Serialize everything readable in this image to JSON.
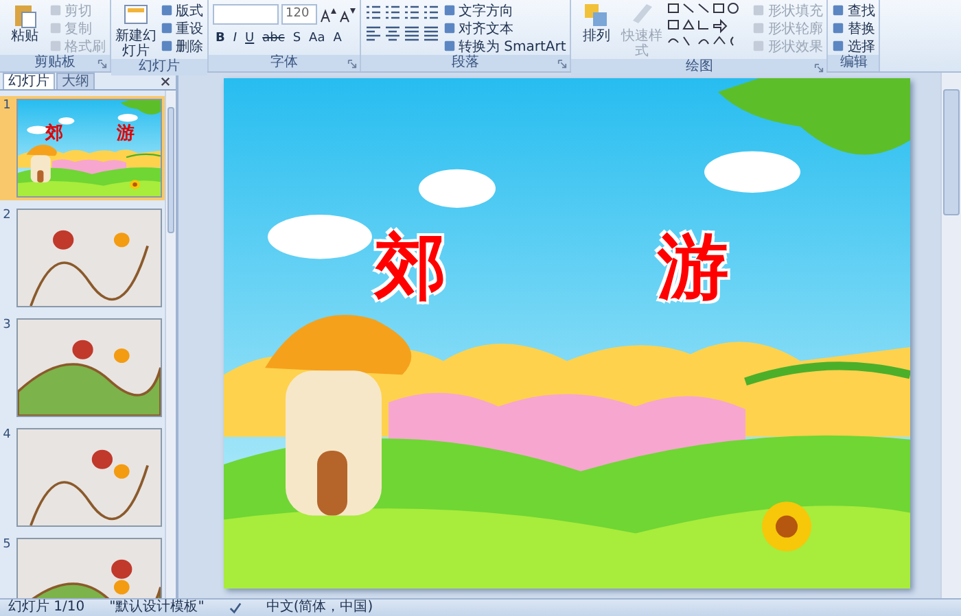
{
  "ribbon": {
    "groups": [
      {
        "kind": "standard",
        "label": "剪贴板",
        "launcher": true,
        "large": [
          {
            "label": "粘贴",
            "kind": "paste"
          }
        ],
        "items": [
          {
            "label": "剪切",
            "disabled": true
          },
          {
            "label": "复制",
            "disabled": true
          },
          {
            "label": "格式刷",
            "disabled": true
          }
        ]
      },
      {
        "kind": "standard",
        "label": "幻灯片",
        "launcher": false,
        "large": [
          {
            "label": "新建幻灯片",
            "kind": "slide"
          }
        ],
        "items": [
          {
            "label": "版式",
            "disabled": false
          },
          {
            "label": "重设",
            "disabled": false
          },
          {
            "label": "删除",
            "disabled": false
          }
        ]
      },
      {
        "kind": "font",
        "label": "字体",
        "launcher": true,
        "font_size": "120",
        "format_buttons": [
          "B",
          "I",
          "U",
          "abc",
          "S",
          "Aa",
          "A"
        ]
      },
      {
        "kind": "paragraph",
        "label": "段落",
        "launcher": true,
        "items": [
          {
            "label": "文字方向",
            "disabled": false
          },
          {
            "label": "对齐文本",
            "disabled": false
          },
          {
            "label": "转换为 SmartArt",
            "disabled": false
          }
        ]
      },
      {
        "kind": "drawing",
        "label": "绘图",
        "launcher": true,
        "large": [
          {
            "label": "排列",
            "kind": "arrange",
            "disabled": false
          },
          {
            "label": "快速样式",
            "kind": "style",
            "disabled": true
          }
        ],
        "items": [
          {
            "label": "形状填充",
            "disabled": true
          },
          {
            "label": "形状轮廓",
            "disabled": true
          },
          {
            "label": "形状效果",
            "disabled": true
          }
        ]
      },
      {
        "kind": "standard",
        "label": "编辑",
        "launcher": false,
        "items": [
          {
            "label": "查找",
            "disabled": false
          },
          {
            "label": "替换",
            "disabled": false
          },
          {
            "label": "选择",
            "disabled": false
          }
        ]
      }
    ]
  },
  "panel_tabs": [
    {
      "label": "幻灯片",
      "selected": true
    },
    {
      "label": "大纲",
      "selected": false
    }
  ],
  "slides": [
    {
      "number": "1",
      "selected": true,
      "kind": "title",
      "titles": [
        "郊",
        "游"
      ]
    },
    {
      "number": "2",
      "selected": false,
      "kind": "painting"
    },
    {
      "number": "3",
      "selected": false,
      "kind": "painting"
    },
    {
      "number": "4",
      "selected": false,
      "kind": "painting"
    },
    {
      "number": "5",
      "selected": false,
      "kind": "painting"
    }
  ],
  "slide": {
    "titles": [
      "郊",
      "游"
    ]
  },
  "status_bar": {
    "slide": "幻灯片 1/10",
    "theme": "\"默认设计模板\"",
    "language": "中文(简体，中国)"
  }
}
